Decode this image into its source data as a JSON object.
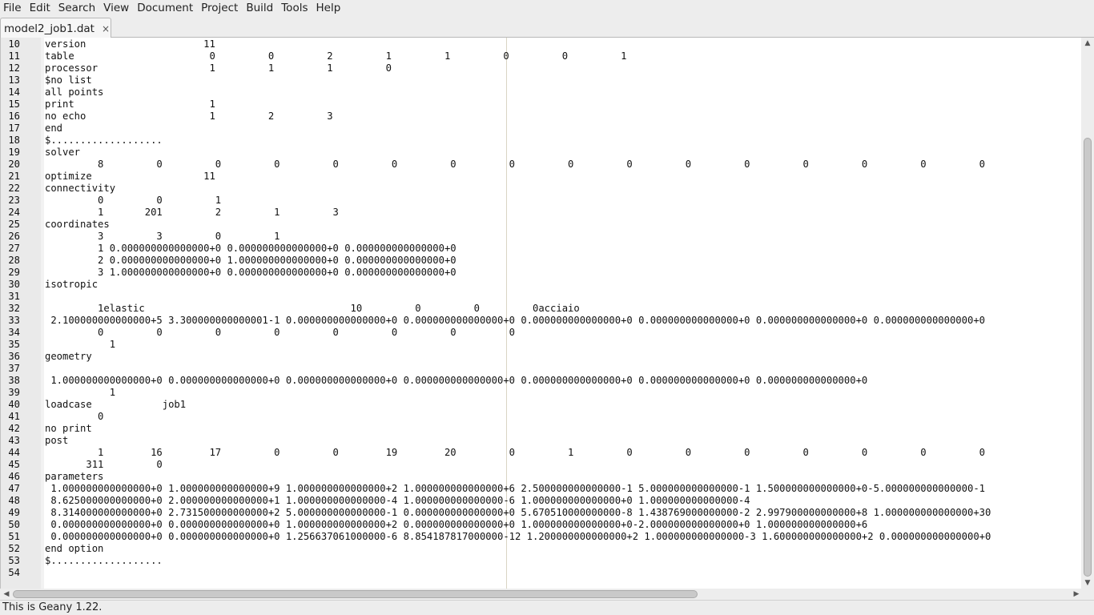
{
  "menu": [
    "File",
    "Edit",
    "Search",
    "View",
    "Document",
    "Project",
    "Build",
    "Tools",
    "Help"
  ],
  "tab": {
    "label": "model2_job1.dat",
    "close": "×"
  },
  "icons": {
    "tab_close": "close-icon",
    "scroll_up": "arrow-up-icon",
    "scroll_down": "arrow-down-icon",
    "scroll_left": "arrow-left-icon",
    "scroll_right": "arrow-right-icon"
  },
  "editor": {
    "lines": [
      {
        "n": "10",
        "t": "version                    11"
      },
      {
        "n": "11",
        "t": "table                       0         0         2         1         1         0         0         1"
      },
      {
        "n": "12",
        "t": "processor                   1         1         1         0"
      },
      {
        "n": "13",
        "t": "$no list"
      },
      {
        "n": "14",
        "t": "all points"
      },
      {
        "n": "15",
        "t": "print                       1"
      },
      {
        "n": "16",
        "t": "no echo                     1         2         3"
      },
      {
        "n": "17",
        "t": "end"
      },
      {
        "n": "18",
        "t": "$..................."
      },
      {
        "n": "19",
        "t": "solver"
      },
      {
        "n": "20",
        "t": "         8         0         0         0         0         0         0         0         0         0         0         0         0         0         0         0"
      },
      {
        "n": "21",
        "t": "optimize                   11"
      },
      {
        "n": "22",
        "t": "connectivity"
      },
      {
        "n": "23",
        "t": "         0         0         1"
      },
      {
        "n": "24",
        "t": "         1       201         2         1         3"
      },
      {
        "n": "25",
        "t": "coordinates"
      },
      {
        "n": "26",
        "t": "         3         3         0         1"
      },
      {
        "n": "27",
        "t": "         1 0.000000000000000+0 0.000000000000000+0 0.000000000000000+0"
      },
      {
        "n": "28",
        "t": "         2 0.000000000000000+0 1.000000000000000+0 0.000000000000000+0"
      },
      {
        "n": "29",
        "t": "         3 1.000000000000000+0 0.000000000000000+0 0.000000000000000+0"
      },
      {
        "n": "30",
        "t": "isotropic"
      },
      {
        "n": "31",
        "t": ""
      },
      {
        "n": "32",
        "t": "         1elastic                                   10         0         0         0acciaio"
      },
      {
        "n": "33",
        "t": " 2.100000000000000+5 3.300000000000001-1 0.000000000000000+0 0.000000000000000+0 0.000000000000000+0 0.000000000000000+0 0.000000000000000+0 0.000000000000000+0"
      },
      {
        "n": "34",
        "t": "         0         0         0         0         0         0         0         0"
      },
      {
        "n": "35",
        "t": "           1"
      },
      {
        "n": "36",
        "t": "geometry"
      },
      {
        "n": "37",
        "t": ""
      },
      {
        "n": "38",
        "t": " 1.000000000000000+0 0.000000000000000+0 0.000000000000000+0 0.000000000000000+0 0.000000000000000+0 0.000000000000000+0 0.000000000000000+0"
      },
      {
        "n": "39",
        "t": "           1"
      },
      {
        "n": "40",
        "t": "loadcase            job1"
      },
      {
        "n": "41",
        "t": "         0"
      },
      {
        "n": "42",
        "t": "no print"
      },
      {
        "n": "43",
        "t": "post"
      },
      {
        "n": "44",
        "t": "         1        16        17         0         0        19        20         0         1         0         0         0         0         0         0         0"
      },
      {
        "n": "45",
        "t": "       311         0"
      },
      {
        "n": "46",
        "t": "parameters"
      },
      {
        "n": "47",
        "t": " 1.000000000000000+0 1.000000000000000+9 1.000000000000000+2 1.000000000000000+6 2.500000000000000-1 5.000000000000000-1 1.500000000000000+0-5.000000000000000-1"
      },
      {
        "n": "48",
        "t": " 8.625000000000000+0 2.000000000000000+1 1.000000000000000-4 1.000000000000000-6 1.000000000000000+0 1.000000000000000-4"
      },
      {
        "n": "49",
        "t": " 8.314000000000000+0 2.731500000000000+2 5.000000000000000-1 0.000000000000000+0 5.670510000000000-8 1.438769000000000-2 2.997900000000000+8 1.000000000000000+30"
      },
      {
        "n": "50",
        "t": " 0.000000000000000+0 0.000000000000000+0 1.000000000000000+2 0.000000000000000+0 1.000000000000000+0-2.000000000000000+0 1.000000000000000+6"
      },
      {
        "n": "51",
        "t": " 0.000000000000000+0 0.000000000000000+0 1.256637061000000-6 8.854187817000000-12 1.200000000000000+2 1.000000000000000-3 1.600000000000000+2 0.000000000000000+0"
      },
      {
        "n": "52",
        "t": "end option"
      },
      {
        "n": "53",
        "t": "$..................."
      },
      {
        "n": "54",
        "t": ""
      }
    ]
  },
  "statusbar": {
    "text": "This is Geany 1.22."
  }
}
